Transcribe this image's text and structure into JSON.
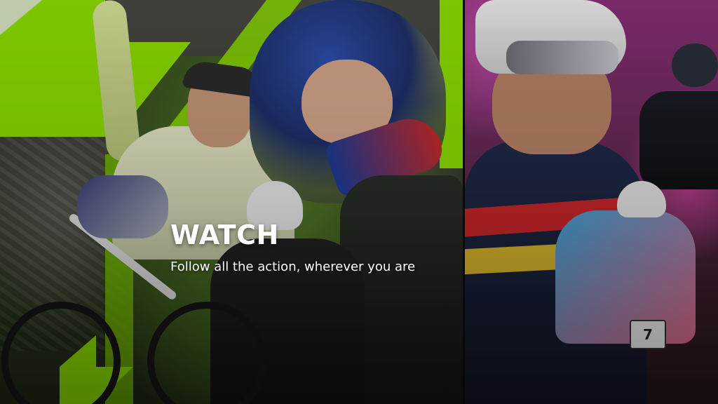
{
  "hero": {
    "title": "WATCH",
    "subtitle": "Follow all the action, wherever you are",
    "accent_color": "#8ee000",
    "text_color": "#ffffff"
  },
  "images": {
    "left_collage": "downhill-and-enduro-riders-collage",
    "right_photo": "cross-country-riders-race"
  },
  "visible_marks": {
    "race_number": "7"
  }
}
